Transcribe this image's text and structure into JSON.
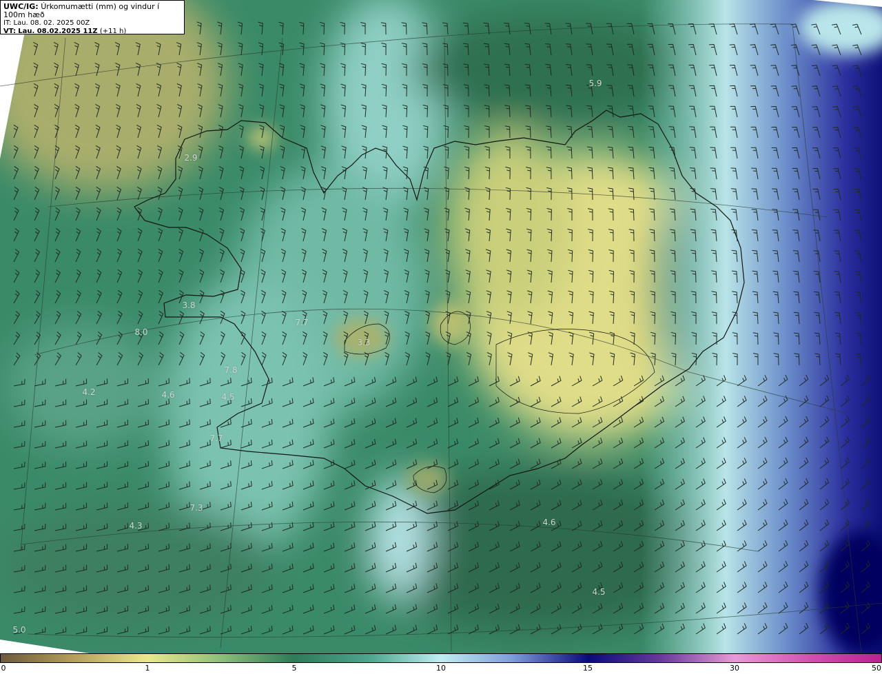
{
  "header": {
    "model": "UWC/IG:",
    "title": "Úrkomumætti (mm) og vindur í 100m hæð",
    "it_label": "IT:",
    "it_value": "Lau. 08. 02. 2025 00Z",
    "vt_label": "VT:",
    "vt_value": "Lau. 08.02.2025 11Z",
    "vt_offset": "(+11 h)"
  },
  "colorbar": {
    "ticks": [
      "0",
      "1",
      "5",
      "10",
      "15",
      "30",
      "50"
    ]
  },
  "value_labels": [
    "5.9",
    "2.9",
    "3.8",
    "8.0",
    "7.7",
    "3.3",
    "7.8",
    "4.2",
    "4.6",
    "4.5",
    "7.7",
    "7.3",
    "4.3",
    "4.6",
    "4.5",
    "5.0"
  ],
  "colors": {
    "dark_green": "#2c6b4d",
    "mid_green": "#3f8c6a",
    "light_teal": "#8fd2c6",
    "pale_yellow": "#e6e28a",
    "olive": "#a9b066",
    "light_blue": "#c5ecf0",
    "blue": "#5a70c0",
    "navy": "#0a0a78"
  }
}
